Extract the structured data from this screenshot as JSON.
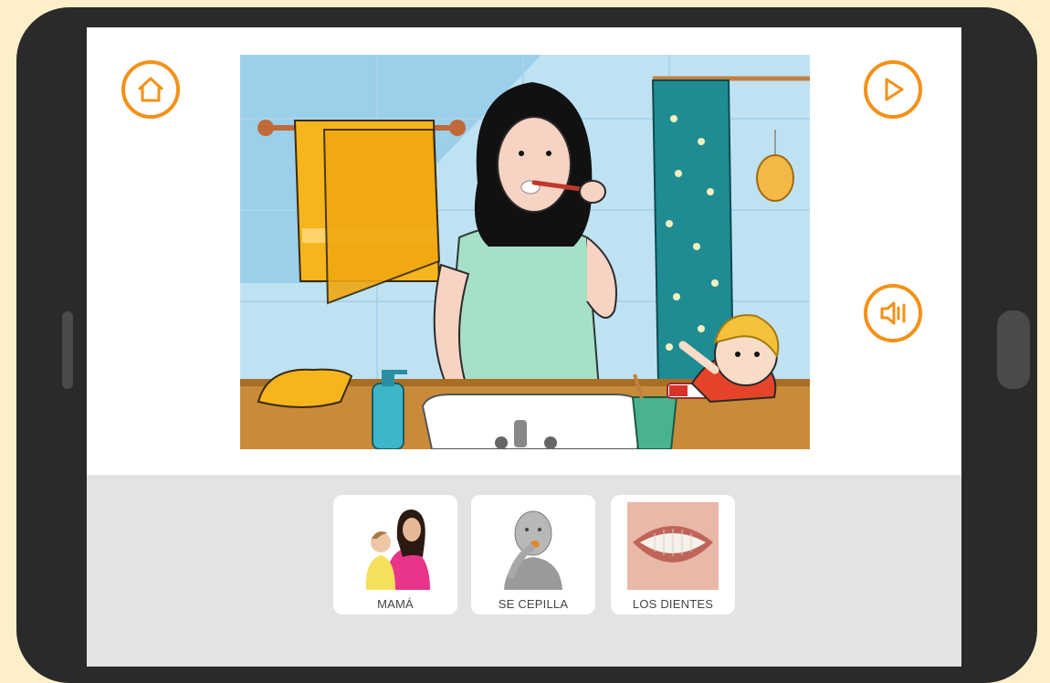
{
  "app": {
    "accent_color": "#f39118",
    "toolbar": {
      "home_icon": "home-icon",
      "play_icon": "play-icon",
      "audio_icon": "speaker-icon"
    },
    "scene": {
      "description_icon": "bathroom-illustration"
    },
    "pictograms": [
      {
        "label": "MAMÁ"
      },
      {
        "label": "SE CEPILLA"
      },
      {
        "label": "LOS DIENTES"
      }
    ]
  }
}
